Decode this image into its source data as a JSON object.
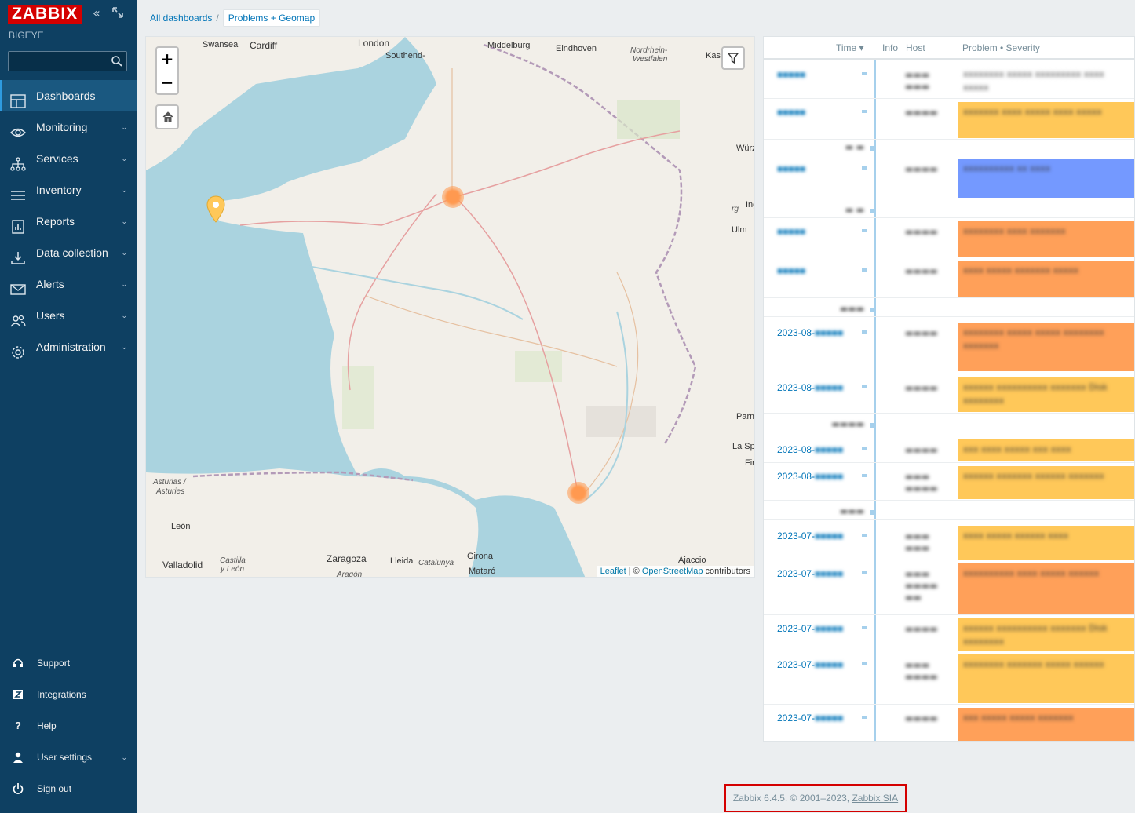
{
  "sidebar": {
    "logo": "ZABBIX",
    "server_name": "BIGEYE",
    "collapse_icon": "chevrons-left-icon",
    "kiosk_icon": "kiosk-mode-icon",
    "search": {
      "value": "",
      "placeholder": ""
    },
    "menu": [
      {
        "label": "Dashboards",
        "icon": "dashboard-icon",
        "active": true,
        "has_submenu": false
      },
      {
        "label": "Monitoring",
        "icon": "eye-icon",
        "active": false,
        "has_submenu": true
      },
      {
        "label": "Services",
        "icon": "services-icon",
        "active": false,
        "has_submenu": true
      },
      {
        "label": "Inventory",
        "icon": "list-icon",
        "active": false,
        "has_submenu": true
      },
      {
        "label": "Reports",
        "icon": "report-icon",
        "active": false,
        "has_submenu": true
      },
      {
        "label": "Data collection",
        "icon": "download-icon",
        "active": false,
        "has_submenu": true
      },
      {
        "label": "Alerts",
        "icon": "envelope-icon",
        "active": false,
        "has_submenu": true
      },
      {
        "label": "Users",
        "icon": "users-icon",
        "active": false,
        "has_submenu": true
      },
      {
        "label": "Administration",
        "icon": "gear-icon",
        "active": false,
        "has_submenu": true
      }
    ],
    "bottom_menu": [
      {
        "label": "Support",
        "icon": "headset-icon"
      },
      {
        "label": "Integrations",
        "icon": "z-icon"
      },
      {
        "label": "Help",
        "icon": "question-icon"
      },
      {
        "label": "User settings",
        "icon": "user-icon"
      },
      {
        "label": "Sign out",
        "icon": "power-icon"
      }
    ]
  },
  "breadcrumb": {
    "root": "All dashboards",
    "separator": "/",
    "current": "Problems + Geomap"
  },
  "map": {
    "labels": [
      "Swansea",
      "Cardiff",
      "London",
      "Southend-",
      "Middelburg",
      "Eindhoven",
      "Nordrhein-",
      "Westfalen",
      "Kass",
      "Würz",
      "Ing",
      "rg",
      "Ulm",
      "Parm",
      "La Spe",
      "Fir",
      "Asturias /",
      "Asturies",
      "León",
      "Valladolid",
      "Castilla",
      "y León",
      "Aragón",
      "Zaragoza",
      "Lleida",
      "Catalunya",
      "Girona",
      "Mataró",
      "Ajaccio"
    ],
    "zoom_in": "+",
    "zoom_out": "−",
    "attribution": {
      "leaflet": "Leaflet",
      "separator": " | © ",
      "osm": "OpenStreetMap",
      "suffix": " contributors"
    },
    "severity_colors": {
      "average": "#ffa059",
      "warning": "#ffc859"
    }
  },
  "problems": {
    "columns": {
      "time": "Time ▾",
      "info": "Info",
      "host": "Host",
      "problem": "Problem • Severity"
    },
    "rows": [
      {
        "time_visible": "",
        "severity": "none",
        "problem": "xxxxxxxx xxxxx xxxxxxxxx xxxx xxxxx"
      },
      {
        "time_visible": "",
        "severity": "warning",
        "problem": "xxxxxxx xxxx xxxxx xxxx xxxxx"
      },
      {
        "time_visible": "",
        "severity": "info",
        "problem": "xxxxxxxxxx xx xxxx"
      },
      {
        "time_visible": "",
        "severity": "average",
        "problem": "xxxxxxxx xxxx xxxxxxx"
      },
      {
        "time_visible": "",
        "severity": "average",
        "problem": "xxxx xxxxx xxxxxxx xxxxx"
      },
      {
        "time_visible": "2023-08-",
        "severity": "average",
        "problem": "xxxxxxxx xxxxx xxxxx xxxxxxxx xxxxxxx"
      },
      {
        "time_visible": "2023-08-",
        "severity": "warning",
        "problem": "xxxxxx xxxxxxxxxx xxxxxxx Disk xxxxxxxx"
      },
      {
        "time_visible": "2023-08-",
        "severity": "warning",
        "problem": "xxx xxxx xxxxx xxx xxxx"
      },
      {
        "time_visible": "2023-08-",
        "severity": "warning",
        "problem": "xxxxxx xxxxxxx xxxxxx xxxxxxx"
      },
      {
        "time_visible": "2023-07-",
        "severity": "warning",
        "problem": "xxxx xxxxx xxxxxx xxxx"
      },
      {
        "time_visible": "2023-07-",
        "severity": "average",
        "problem": "xxxxxxxxxx xxxx xxxxx xxxxxx"
      },
      {
        "time_visible": "2023-07-",
        "severity": "warning",
        "problem": "xxxxxx xxxxxxxxxx xxxxxxx Disk xxxxxxxx"
      },
      {
        "time_visible": "2023-07-",
        "severity": "warning",
        "problem": "xxxxxxxx xxxxxxx xxxxx xxxxxx"
      },
      {
        "time_visible": "2023-07-",
        "severity": "average",
        "problem": "xxx xxxxx xxxxx xxxxxxx"
      }
    ]
  },
  "footer": {
    "text": "Zabbix 6.4.5. © 2001–2023, ",
    "link": "Zabbix SIA"
  }
}
